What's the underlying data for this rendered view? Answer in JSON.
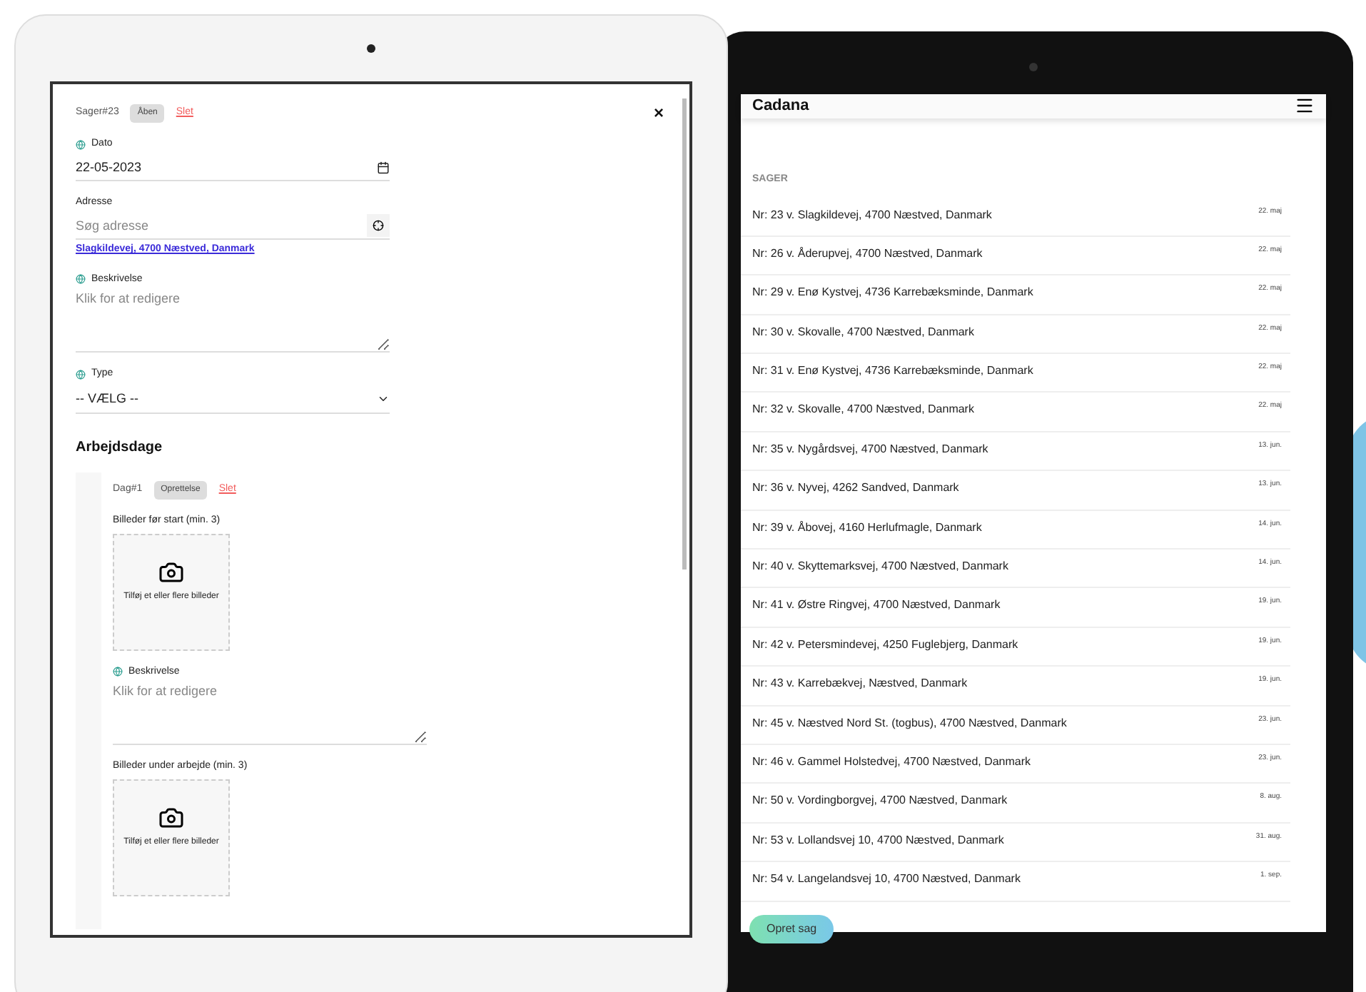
{
  "case_form": {
    "case_id": "Sager#23",
    "status": "Åben",
    "delete": "Slet",
    "close": "×",
    "fields": [
      {
        "kind": "date",
        "label": "Dato",
        "value": "22-05-2023"
      },
      {
        "kind": "address",
        "label": "Adresse",
        "placeholder": "Søg adresse",
        "link": "Slagkildevej, 4700 Næstved, Danmark"
      },
      {
        "kind": "textarea",
        "label": "Beskrivelse",
        "placeholder": "Klik for at redigere"
      },
      {
        "kind": "select",
        "label": "Type",
        "value": "-- VÆLG --"
      }
    ],
    "section_title": "Arbejdsdage",
    "day": {
      "id": "Dag#1",
      "status": "Oprettelse",
      "delete": "Slet",
      "blocks": [
        {
          "kind": "photos",
          "label": "Billeder før start (min. 3)",
          "hint": "Tilføj et eller flere billeder"
        },
        {
          "kind": "textarea",
          "label": "Beskrivelse",
          "placeholder": "Klik for at redigere"
        },
        {
          "kind": "photos",
          "label": "Billeder under arbejde (min. 3)",
          "hint": "Tilføj et eller flere billeder"
        }
      ]
    }
  },
  "case_list": {
    "app_title": "Cadana",
    "section": "SAGER",
    "button": "Opret sag",
    "rows": [
      {
        "title": "Nr: 23 v. Slagkildevej, 4700 Næstved, Danmark",
        "date": "22. maj"
      },
      {
        "title": "Nr: 26 v. Åderupvej, 4700 Næstved, Danmark",
        "date": "22. maj"
      },
      {
        "title": "Nr: 29 v. Enø Kystvej, 4736 Karrebæksminde, Danmark",
        "date": "22. maj"
      },
      {
        "title": "Nr: 30 v. Skovalle, 4700 Næstved, Danmark",
        "date": "22. maj"
      },
      {
        "title": "Nr: 31 v. Enø Kystvej, 4736 Karrebæksminde, Danmark",
        "date": "22. maj"
      },
      {
        "title": "Nr: 32 v. Skovalle, 4700 Næstved, Danmark",
        "date": "22. maj"
      },
      {
        "title": "Nr: 35 v. Nygårdsvej, 4700 Næstved, Danmark",
        "date": "13. jun."
      },
      {
        "title": "Nr: 36 v. Nyvej, 4262 Sandved, Danmark",
        "date": "13. jun."
      },
      {
        "title": "Nr: 39 v. Åbovej, 4160 Herlufmagle, Danmark",
        "date": "14. jun."
      },
      {
        "title": "Nr: 40 v. Skyttemarksvej, 4700 Næstved, Danmark",
        "date": "14. jun."
      },
      {
        "title": "Nr: 41 v. Østre Ringvej, 4700 Næstved, Danmark",
        "date": "19. jun."
      },
      {
        "title": "Nr: 42 v. Petersmindevej, 4250 Fuglebjerg, Danmark",
        "date": "19. jun."
      },
      {
        "title": "Nr: 43 v. Karrebækvej, Næstved, Danmark",
        "date": "19. jun."
      },
      {
        "title": "Nr: 45 v. Næstved Nord St. (togbus), 4700 Næstved, Danmark",
        "date": "23. jun."
      },
      {
        "title": "Nr: 46 v. Gammel Holstedvej, 4700 Næstved, Danmark",
        "date": "23. jun."
      },
      {
        "title": "Nr: 50 v. Vordingborgvej, 4700 Næstved, Danmark",
        "date": "8. aug."
      },
      {
        "title": "Nr: 53 v. Lollandsvej 10, 4700 Næstved, Danmark",
        "date": "31. aug."
      },
      {
        "title": "Nr: 54 v. Langelandsvej 10, 4700 Næstved, Danmark",
        "date": "1. sep."
      }
    ]
  }
}
